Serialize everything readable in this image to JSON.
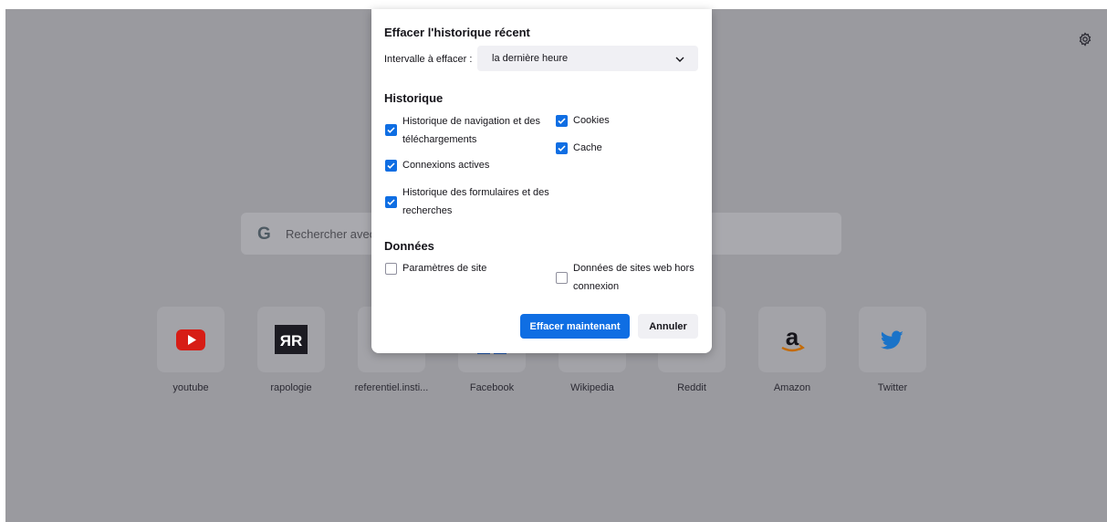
{
  "new_tab": {
    "search_placeholder": "Rechercher avec Google ou saisir une adresse",
    "search_logo": "G",
    "settings_icon": "gear-icon",
    "shortcuts": [
      {
        "label": "youtube",
        "icon": "youtube-icon",
        "color": "#e62117"
      },
      {
        "label": "rapologie",
        "icon": "rapologie-icon",
        "glyph": "ЯR",
        "color": "#1c1b22"
      },
      {
        "label": "referentiel.insti...",
        "icon": "referentiel-icon",
        "color": "#7542e5"
      },
      {
        "label": "Facebook",
        "icon": "facebook-icon",
        "color": "#1877f2"
      },
      {
        "label": "Wikipedia",
        "icon": "wikipedia-icon",
        "color": "#000000"
      },
      {
        "label": "Reddit",
        "icon": "reddit-icon",
        "color": "#ff4500"
      },
      {
        "label": "Amazon",
        "icon": "amazon-icon",
        "glyph": "a",
        "color": "#15141a"
      },
      {
        "label": "Twitter",
        "icon": "twitter-icon",
        "color": "#1d9bf0"
      }
    ]
  },
  "dialog": {
    "title": "Effacer l'historique récent",
    "range_label": "Intervalle à effacer :",
    "range_value": "la dernière heure",
    "history_heading": "Historique",
    "data_heading": "Données",
    "accent_color": "#0f6ee3",
    "options": {
      "browsing": {
        "label_line1": "Historique de navigation et des",
        "label_line2": "téléchargements",
        "checked": true
      },
      "cookies": {
        "label": "Cookies",
        "checked": true
      },
      "cache": {
        "label": "Cache",
        "checked": true
      },
      "active_logins": {
        "label": "Connexions actives",
        "checked": true
      },
      "forms": {
        "label_line1": "Historique des formulaires et des",
        "label_line2": "recherches",
        "checked": true
      },
      "site_settings": {
        "label": "Paramètres de site",
        "checked": false
      },
      "offline_data": {
        "label_line1": "Données de sites web hors",
        "label_line2": "connexion",
        "checked": false
      }
    },
    "clear_button": "Effacer maintenant",
    "cancel_button": "Annuler"
  }
}
